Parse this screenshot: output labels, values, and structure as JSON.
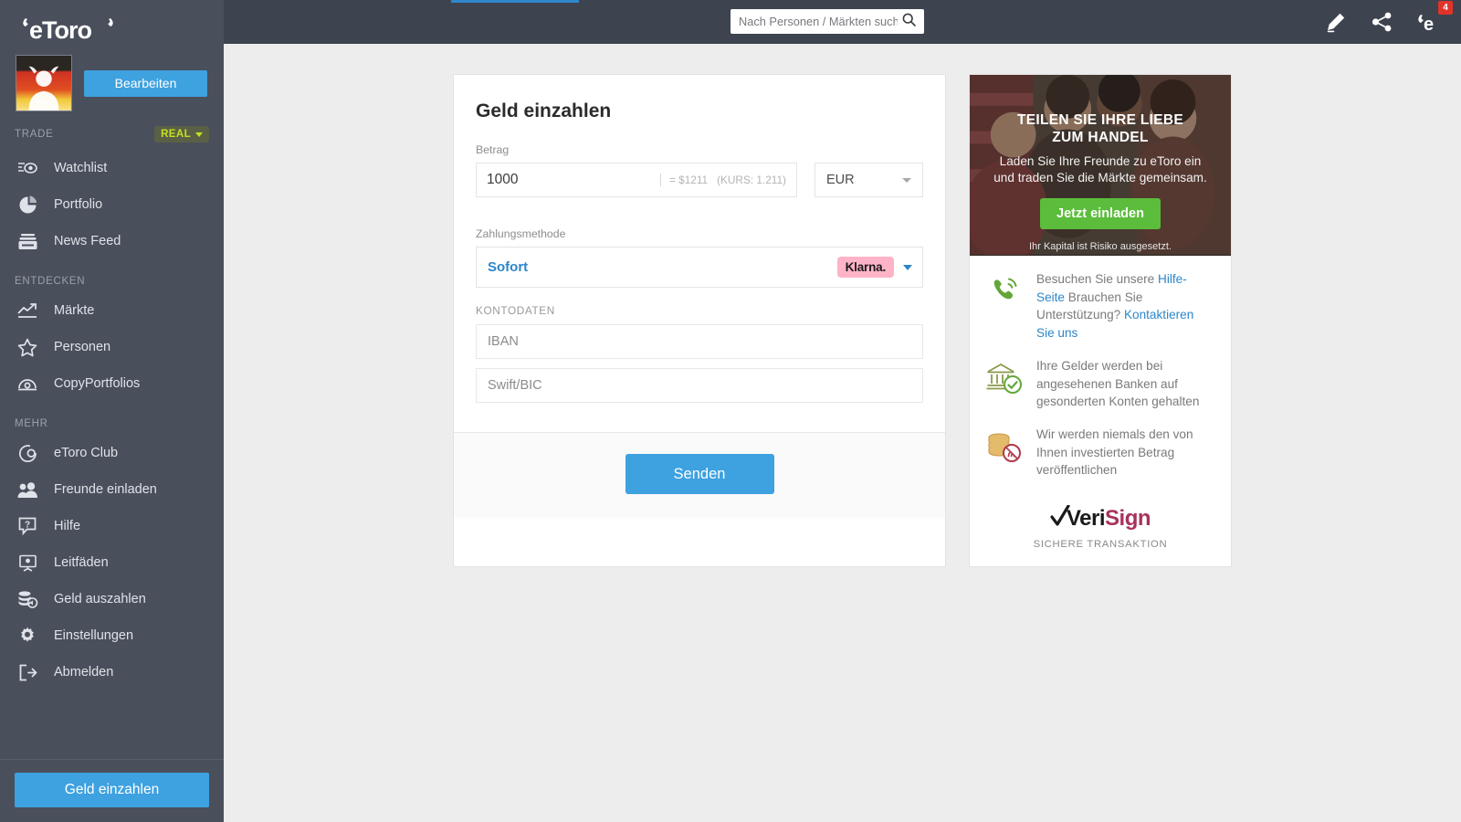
{
  "brand": {
    "name": "eToro",
    "accent": "#3ea1e0",
    "green": "#5bbd3b",
    "klarna_pink": "#ffb3c7"
  },
  "sidebar": {
    "logo_text": "eToro",
    "edit_button": "Bearbeiten",
    "trade_label": "TRADE",
    "account_mode": "REAL",
    "trade_items": [
      {
        "label": "Watchlist",
        "icon": "watchlist-icon"
      },
      {
        "label": "Portfolio",
        "icon": "portfolio-icon"
      },
      {
        "label": "News Feed",
        "icon": "news-feed-icon"
      }
    ],
    "discover_label": "ENTDECKEN",
    "discover_items": [
      {
        "label": "Märkte",
        "icon": "markets-icon"
      },
      {
        "label": "Personen",
        "icon": "people-star-icon"
      },
      {
        "label": "CopyPortfolios",
        "icon": "copyportfolios-icon"
      }
    ],
    "more_label": "MEHR",
    "more_items": [
      {
        "label": "eToro Club",
        "icon": "club-icon"
      },
      {
        "label": "Freunde einladen",
        "icon": "invite-friends-icon"
      },
      {
        "label": "Hilfe",
        "icon": "help-icon"
      },
      {
        "label": "Leitfäden",
        "icon": "guides-icon"
      },
      {
        "label": "Geld auszahlen",
        "icon": "withdraw-icon"
      },
      {
        "label": "Einstellungen",
        "icon": "gear-icon"
      },
      {
        "label": "Abmelden",
        "icon": "logout-icon"
      }
    ],
    "deposit_button": "Geld einzahlen"
  },
  "topbar": {
    "search_placeholder": "Nach Personen / Märkten suchen",
    "search_value": "",
    "notification_count": "4"
  },
  "deposit_form": {
    "title": "Geld einzahlen",
    "amount_label": "Betrag",
    "amount_value": "1000",
    "converted": "= $1211",
    "rate": "(KURS: 1.211)",
    "currency": "EUR",
    "payment_method_label": "Zahlungsmethode",
    "payment_method_name": "Sofort",
    "payment_provider": "Klarna.",
    "account_details_label": "KONTODATEN",
    "iban_placeholder": "IBAN",
    "iban_value": "",
    "swift_placeholder": "Swift/BIC",
    "swift_value": "",
    "submit_button": "Senden"
  },
  "promo": {
    "hero_title_line1": "TEILEN SIE IHRE LIEBE",
    "hero_title_line2": "ZUM HANDEL",
    "hero_sub_line1": "Laden Sie Ihre Freunde zu eToro ein",
    "hero_sub_line2": "und traden Sie die Märkte gemeinsam.",
    "hero_cta": "Jetzt einladen",
    "hero_risk": "Ihr Kapital ist Risiko ausgesetzt.",
    "info_items": [
      {
        "icon": "phone-support-icon",
        "prefix": "Besuchen Sie unsere ",
        "link1": "Hilfe-Seite",
        "middle": " Brauchen Sie Unterstützung? ",
        "link2": "Kontaktieren Sie uns",
        "suffix": ""
      },
      {
        "icon": "bank-check-icon",
        "text": "Ihre Gelder werden bei angesehenen Banken auf gesonderten Konten gehalten"
      },
      {
        "icon": "coins-private-icon",
        "text": "Wir werden niemals den von Ihnen investierten Betrag veröffentlichen"
      }
    ],
    "verisign_veri": "Veri",
    "verisign_sign": "Sign",
    "verisign_caption": "SICHERE TRANSAKTION"
  }
}
